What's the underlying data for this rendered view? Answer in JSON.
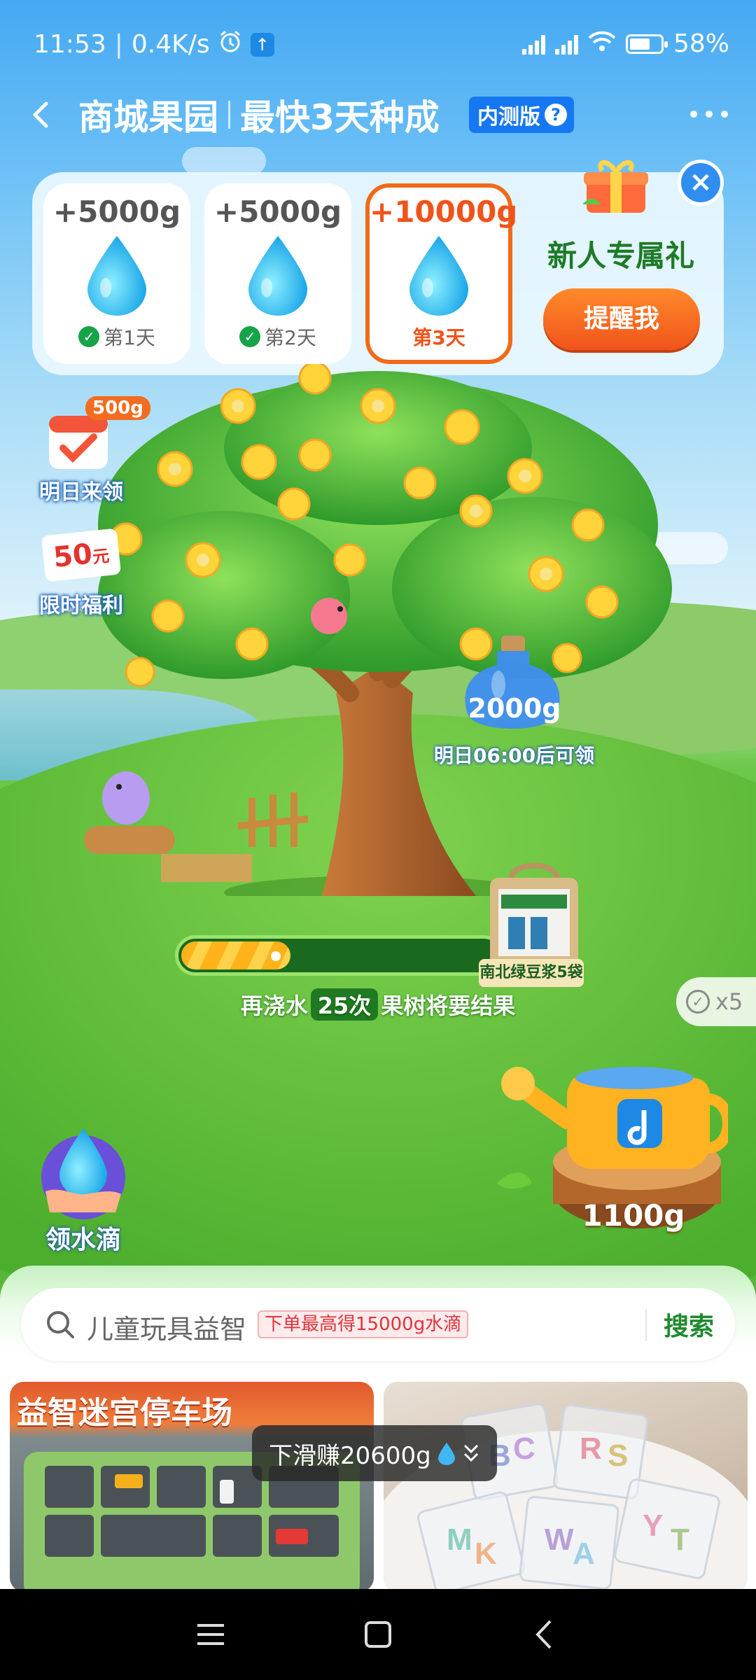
{
  "status": {
    "time": "11:53",
    "speed": "0.4K/s",
    "battery": "58%",
    "battery_level": 0.58
  },
  "header": {
    "title_left": "商城果园",
    "title_right": "最快3天种成",
    "beta_label": "内测版"
  },
  "gift": {
    "days": [
      {
        "amount": "+5000g",
        "label": "第1天",
        "done": true
      },
      {
        "amount": "+5000g",
        "label": "第2天",
        "done": true
      },
      {
        "amount": "+10000g",
        "label": "第3天",
        "done": false
      }
    ],
    "title": "新人专属礼",
    "remind_button": "提醒我"
  },
  "side": {
    "tomorrow_badge": "500g",
    "tomorrow_label": "明日来领",
    "limited_amount": "50",
    "limited_unit": "元",
    "limited_label": "限时福利"
  },
  "bottle": {
    "amount": "2000g",
    "note": "明日06:00后可领"
  },
  "progress": {
    "fraction": 0.34,
    "prefix": "再浇水",
    "count": "25次",
    "suffix": "果树将要结果",
    "prize_label": "南北绿豆浆5袋"
  },
  "multiplier": "x5",
  "get_water_label": "领水滴",
  "watering_can_amount": "1100g",
  "search": {
    "query": "儿童玩具益智",
    "promo": "下单最高得15000g水滴",
    "button": "搜索"
  },
  "products": [
    {
      "title": "益智迷宫停车场"
    }
  ],
  "scroll_pill": "下滑赚20600g",
  "colors": {
    "accent_orange": "#f0531a",
    "accent_green": "#1f8a2e",
    "brand_blue": "#1677f2"
  }
}
